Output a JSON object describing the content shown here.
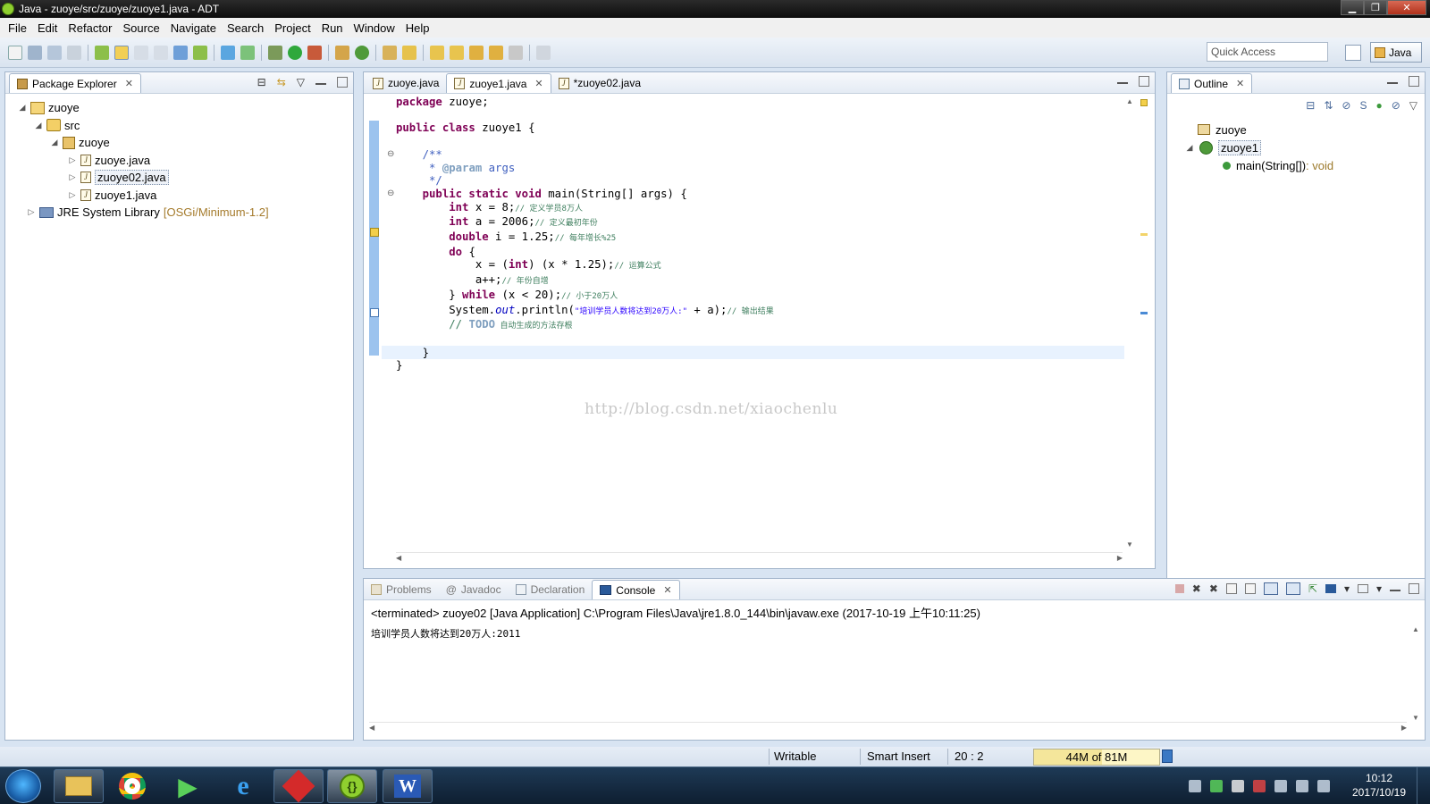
{
  "window": {
    "title": "Java - zuoye/src/zuoye/zuoye1.java - ADT"
  },
  "menu": [
    "File",
    "Edit",
    "Refactor",
    "Source",
    "Navigate",
    "Search",
    "Project",
    "Run",
    "Window",
    "Help"
  ],
  "toolbar": {
    "quick_access_placeholder": "Quick Access",
    "perspective": "Java"
  },
  "package_explorer": {
    "tab_label": "Package Explorer",
    "tree": {
      "project": "zuoye",
      "src": "src",
      "package": "zuoye",
      "files": [
        "zuoye.java",
        "zuoye02.java",
        "zuoye1.java"
      ],
      "library": "JRE System Library",
      "library_tag": "[OSGi/Minimum-1.2]"
    }
  },
  "editor": {
    "tabs": [
      {
        "label": "zuoye.java"
      },
      {
        "label": "zuoye1.java"
      },
      {
        "label": "*zuoye02.java"
      }
    ],
    "code": {
      "l1_kw": "package",
      "l1_rest": " zuoye;",
      "l2_kw": "public class",
      "l2_rest": " zuoye1 {",
      "l3": "    /**",
      "l4_pre": "     * ",
      "l4_tag": "@param",
      "l4_rest": " args",
      "l5": "     */",
      "l6_kw": "    public static void",
      "l6_rest": " main(String[] args) {",
      "l7_kw": "        int",
      "l7_rest": " x = 8;",
      "l7_cm": "// 定义学员8万人",
      "l8_kw": "        int",
      "l8_rest": " a = 2006;",
      "l8_cm": "// 定义最初年份",
      "l9_kw": "        double",
      "l9_rest": " i = 1.25;",
      "l9_cm": "// 每年增长%25",
      "l10_kw": "        do",
      "l10_rest": " {",
      "l11_pre": "            x = (",
      "l11_kw": "int",
      "l11_rest": ") (x * 1.25);",
      "l11_cm": "// 运算公式",
      "l12_rest": "            a++;",
      "l12_cm": "// 年份自增",
      "l13_pre": "        } ",
      "l13_kw": "while",
      "l13_rest": " (x < 20);",
      "l13_cm": "// 小于20万人",
      "l14_pre": "        System.",
      "l14_it": "out",
      "l14_mid": ".println(",
      "l14_st": "\"培训学员人数将达到20万人:\"",
      "l14_rest": " + a);",
      "l14_cm": "// 输出结果",
      "l15_pre": "        // ",
      "l15_todo": "TODO",
      "l15_cm": " 自动生成的方法存根",
      "l16": "    }",
      "l17": "}"
    },
    "watermark": "http://blog.csdn.net/xiaochenlu"
  },
  "outline": {
    "tab_label": "Outline",
    "items": {
      "package": "zuoye",
      "class": "zuoye1",
      "method": "main(String[])",
      "method_type": " : void"
    }
  },
  "bottom_panel": {
    "tabs": [
      "Problems",
      "Javadoc",
      "Declaration",
      "Console"
    ],
    "console_header": "<terminated> zuoye02 [Java Application] C:\\Program Files\\Java\\jre1.8.0_144\\bin\\javaw.exe (2017-10-19 上午10:11:25)",
    "console_output": "培训学员人数将达到20万人:2011"
  },
  "status": {
    "writable": "Writable",
    "insert": "Smart Insert",
    "position": "20 : 2",
    "heap": "44M of 81M"
  },
  "taskbar": {
    "time": "10:12",
    "date": "2017/10/19",
    "word_label": "W"
  },
  "colors": {
    "keyword": "#7f0055",
    "comment": "#3f7f5f",
    "javadoc": "#3f5fbf",
    "string": "#2a00ff",
    "field": "#0000c0",
    "gutter": "#9cc3ee"
  }
}
